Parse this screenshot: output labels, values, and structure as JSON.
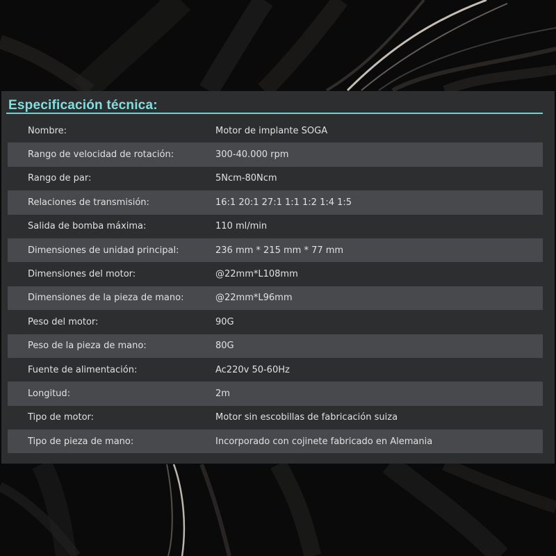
{
  "section": {
    "title": "Especificación técnica:"
  },
  "specs": [
    {
      "label": "Nombre:",
      "value": "Motor de implante SOGA"
    },
    {
      "label": "Rango de velocidad de rotación:",
      "value": "300-40.000 rpm"
    },
    {
      "label": "Rango de par:",
      "value": "5Ncm-80Ncm"
    },
    {
      "label": "Relaciones de transmisión:",
      "value": "16:1 20:1 27:1 1:1 1:2 1:4 1:5"
    },
    {
      "label": "Salida de bomba máxima:",
      "value": "110 ml/min"
    },
    {
      "label": "Dimensiones de unidad principal:",
      "value": "236 mm * 215 mm * 77 mm"
    },
    {
      "label": "Dimensiones del motor:",
      "value": "@22mm*L108mm"
    },
    {
      "label": "Dimensiones de la pieza de mano:",
      "value": "@22mm*L96mm"
    },
    {
      "label": "Peso del motor:",
      "value": "90G"
    },
    {
      "label": "Peso de la pieza de mano:",
      "value": "80G"
    },
    {
      "label": "Fuente de alimentación:",
      "value": "Ac220v 50-60Hz"
    },
    {
      "label": "Longitud:",
      "value": "2m"
    },
    {
      "label": "Tipo de motor:",
      "value": "Motor sin escobillas de fabricación suiza"
    },
    {
      "label": "Tipo de pieza de mano:",
      "value": "Incorporado con cojinete fabricado en Alemania"
    }
  ],
  "colors": {
    "heading_accent": "#7fe0e0",
    "rule": "#6fd2d2",
    "panel": "#2d2e30",
    "row_stripe": "#48494c",
    "text": "#e1e1e1"
  }
}
